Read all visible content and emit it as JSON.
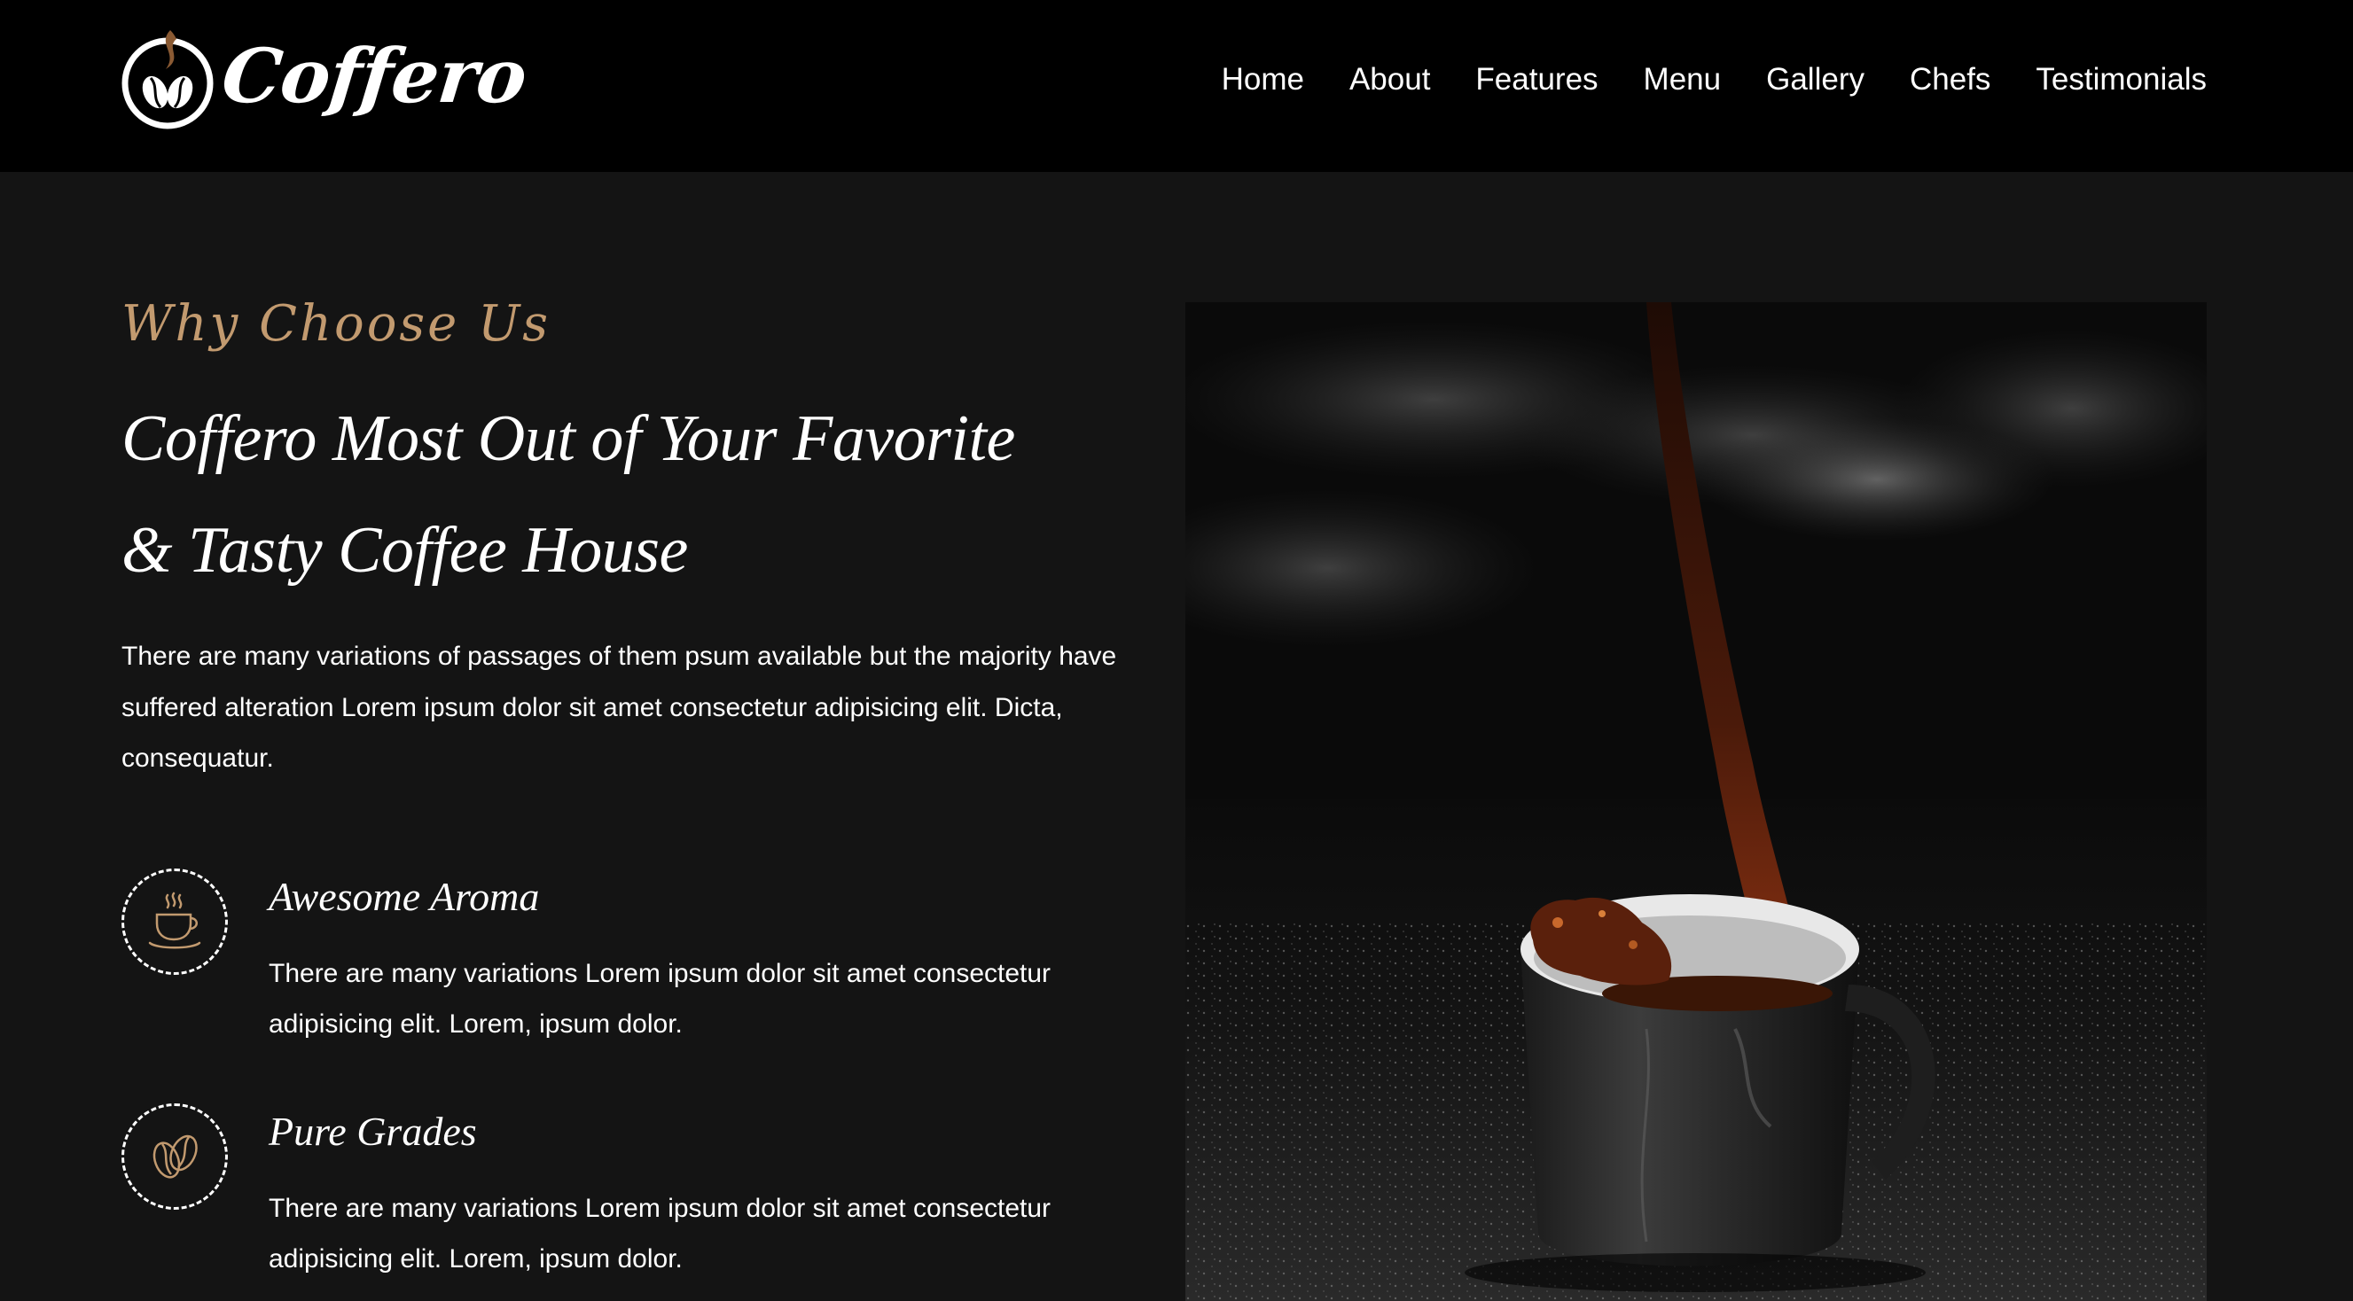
{
  "header": {
    "brand": "Coffero",
    "logo_icon": "coffee-bean-cup-logo-icon",
    "nav": [
      {
        "label": "Home"
      },
      {
        "label": "About"
      },
      {
        "label": "Features"
      },
      {
        "label": "Menu"
      },
      {
        "label": "Gallery"
      },
      {
        "label": "Chefs"
      },
      {
        "label": "Testimonials"
      }
    ]
  },
  "why": {
    "eyebrow": "Why Choose Us",
    "headline_line1": "Coffero Most Out of Your Favorite",
    "headline_line2": "& Tasty Coffee House",
    "intro": "There are many variations of passages of them psum available but the majority have suffered alteration Lorem ipsum dolor sit amet consectetur adipisicing elit. Dicta, consequatur.",
    "features": [
      {
        "icon": "steaming-cup-icon",
        "title": "Awesome Aroma",
        "text": "There are many variations Lorem ipsum dolor sit amet consectetur adipisicing elit. Lorem, ipsum dolor."
      },
      {
        "icon": "coffee-bean-icon",
        "title": "Pure Grades",
        "text": "There are many variations Lorem ipsum dolor sit amet consectetur adipisicing elit. Lorem, ipsum dolor."
      }
    ]
  },
  "colors": {
    "header_bg": "#000000",
    "page_bg": "#141414",
    "accent": "#c29a6f",
    "text": "#ffffff"
  }
}
